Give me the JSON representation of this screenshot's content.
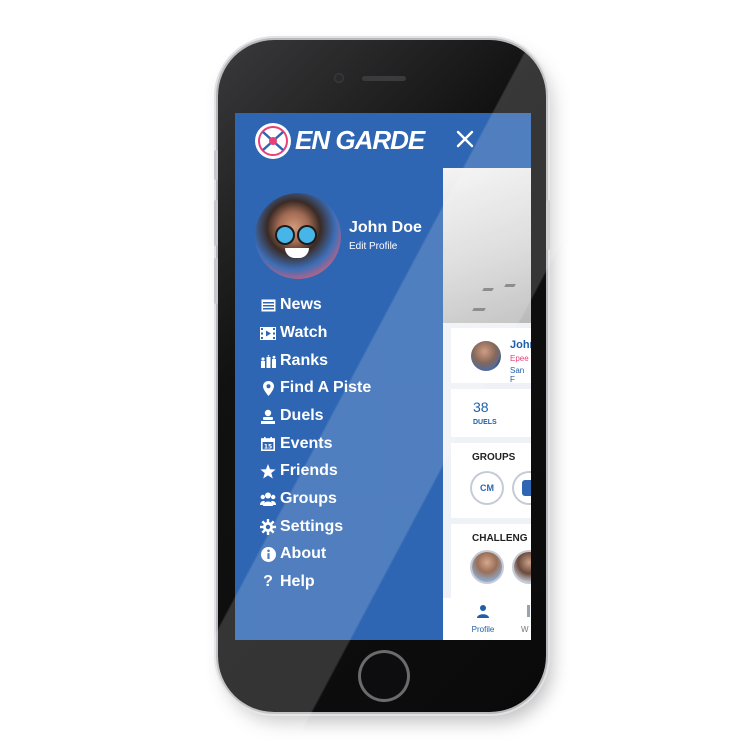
{
  "app": {
    "logo_text": "EN GARDE",
    "close_icon": "close-icon"
  },
  "profile": {
    "name": "John Doe",
    "edit_label": "Edit Profile"
  },
  "menu": [
    {
      "label": "News",
      "icon": "newspaper-icon"
    },
    {
      "label": "Watch",
      "icon": "video-icon"
    },
    {
      "label": "Ranks",
      "icon": "ranks-icon"
    },
    {
      "label": "Find A Piste",
      "icon": "map-pin-icon"
    },
    {
      "label": "Duels",
      "icon": "duel-icon"
    },
    {
      "label": "Events",
      "icon": "calendar-icon"
    },
    {
      "label": "Friends",
      "icon": "star-icon"
    },
    {
      "label": "Groups",
      "icon": "group-icon"
    },
    {
      "label": "Settings",
      "icon": "gear-icon"
    },
    {
      "label": "About",
      "icon": "info-icon"
    },
    {
      "label": "Help",
      "icon": "question-icon"
    }
  ],
  "background_panel": {
    "card_name": "John",
    "card_line2": "Epee",
    "card_line3": "San F",
    "duels_count": "38",
    "duels_label": "DUELS",
    "groups_heading": "GROUPS",
    "challenges_heading": "CHALLENG",
    "group_badge_text": "CM",
    "tabs": [
      {
        "label": "Profile",
        "icon": "person-icon"
      },
      {
        "label": "W",
        "icon": "tab-icon"
      }
    ]
  },
  "colors": {
    "drawer_blue": "#2f66b3",
    "accent_blue": "#1f5ea8",
    "text_white": "#ffffff",
    "pink": "#e8417a"
  }
}
